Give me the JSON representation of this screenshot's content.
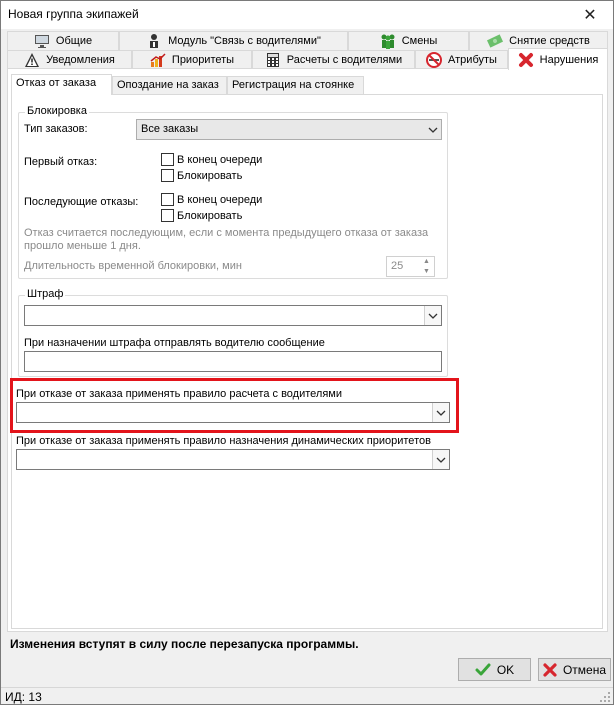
{
  "window": {
    "title": "Новая группа экипажей",
    "close_glyph": "✕"
  },
  "tabs_row1": [
    {
      "label": "Общие",
      "icon": "monitor-icon"
    },
    {
      "label": "Модуль \"Связь с водителями\"",
      "icon": "driver-icon"
    },
    {
      "label": "Смены",
      "icon": "people-icon"
    },
    {
      "label": "Снятие средств",
      "icon": "money-icon"
    }
  ],
  "tabs_row2": [
    {
      "label": "Уведомления",
      "icon": "warning-icon"
    },
    {
      "label": "Приоритеты",
      "icon": "priority-chart-icon"
    },
    {
      "label": "Расчеты с водителями",
      "icon": "calculator-icon"
    },
    {
      "label": "Атрибуты",
      "icon": "no-smoking-icon"
    },
    {
      "label": "Нарушения",
      "icon": "red-x-icon",
      "active": true
    }
  ],
  "subtabs": [
    {
      "label": "Отказ от заказа",
      "active": true
    },
    {
      "label": "Опоздание на заказ"
    },
    {
      "label": "Регистрация на стоянке"
    }
  ],
  "blocking": {
    "group_label": "Блокировка",
    "order_type_label": "Тип заказов:",
    "order_type_value": "Все заказы",
    "first_refusal_label": "Первый отказ:",
    "first_refusal_opt1": "В конец очереди",
    "first_refusal_opt2": "Блокировать",
    "next_refusal_label": "Последующие отказы:",
    "next_refusal_opt1": "В конец очереди",
    "next_refusal_opt2": "Блокировать",
    "note_line1": "Отказ считается последующим, если с момента предыдущего отказа от заказа",
    "note_line2": "прошло меньше 1 дня.",
    "duration_label": "Длительность временной блокировки, мин",
    "duration_value": "25"
  },
  "fine": {
    "group_label": "Штраф",
    "select_value": "",
    "message_label": "При назначении штрафа отправлять водителю сообщение",
    "message_value": ""
  },
  "driver_rule": {
    "label": "При отказе от заказа применять правило расчета с водителями",
    "value": ""
  },
  "priority_rule": {
    "label": "При отказе от заказа применять правило назначения динамических приоритетов",
    "value": ""
  },
  "footer": {
    "notice": "Изменения вступят в силу после перезапуска программы.",
    "ok_label": "OK",
    "cancel_label": "Отмена",
    "status": "ИД: 13"
  },
  "colors": {
    "highlight": "#e3141b",
    "ok_check": "#3aa53a",
    "cancel_x": "#d7262e"
  }
}
